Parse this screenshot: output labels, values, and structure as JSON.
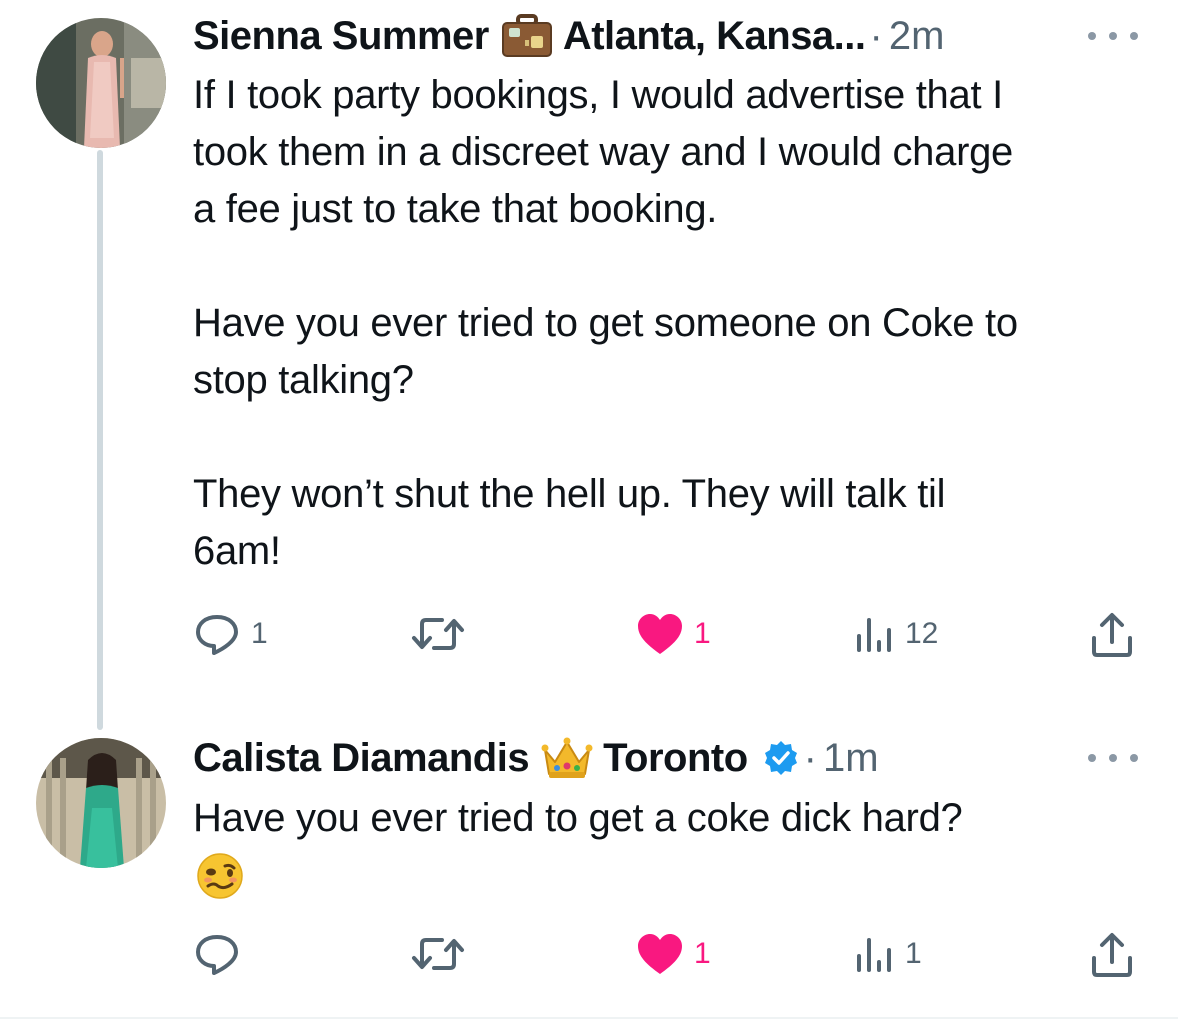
{
  "tweets": [
    {
      "author": "Sienna Summer",
      "author_emoji": "briefcase-emoji",
      "location": "Atlanta, Kansa...",
      "separator": "·",
      "time": "2m",
      "text": "If I took party bookings, I would advertise that I\ntook them in a discreet way and I would charge\na fee just to take that booking.\n\nHave you ever tried to get someone on Coke to\nstop talking?\n\nThey won’t shut the hell up. They will talk til\n6am!",
      "replies": "1",
      "likes": "1",
      "views": "12"
    },
    {
      "author": "Calista Diamandis",
      "author_emoji": "crown-emoji",
      "location": "Toronto",
      "verified": true,
      "separator": "·",
      "time": "1m",
      "text": "Have you ever tried to get a coke dick hard?",
      "reply_emoji": "woozy-face-emoji",
      "replies": "",
      "likes": "1",
      "views": "1"
    }
  ],
  "colors": {
    "text": "#0f1419",
    "muted": "#536471",
    "like": "#f91880",
    "verified": "#1d9bf0",
    "thread_line": "#cfd9de"
  }
}
